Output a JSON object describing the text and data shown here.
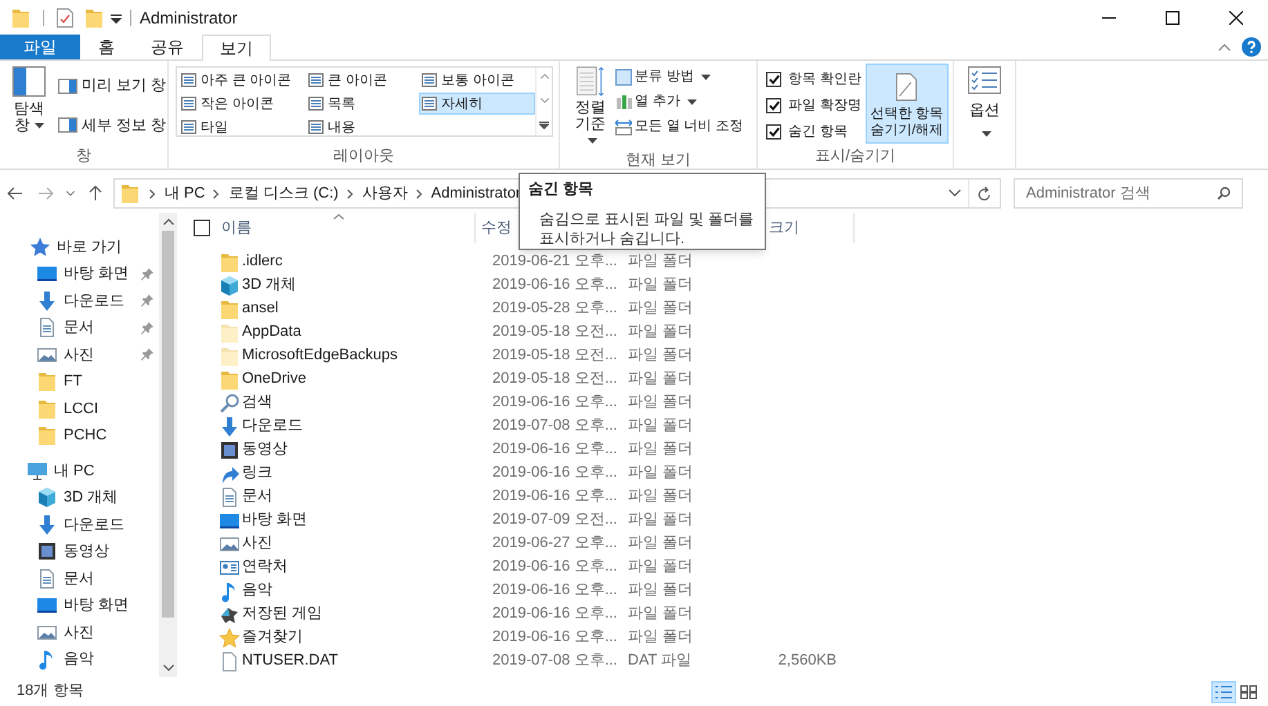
{
  "window": {
    "title": "Administrator"
  },
  "tabs": [
    {
      "label": "파일",
      "kind": "menu",
      "selected": false
    },
    {
      "label": "홈",
      "kind": "tab",
      "selected": false
    },
    {
      "label": "공유",
      "kind": "tab",
      "selected": false
    },
    {
      "label": "보기",
      "kind": "tab",
      "selected": true
    }
  ],
  "ribbon": {
    "panes": {
      "label": "창",
      "navigation_pane": "탐색 창",
      "preview_pane": "미리 보기 창",
      "details_pane": "세부 정보 창"
    },
    "layout": {
      "label": "레이아웃",
      "options": [
        {
          "label": "아주 큰 아이콘",
          "selected": false
        },
        {
          "label": "큰 아이콘",
          "selected": false
        },
        {
          "label": "보통 아이콘",
          "selected": false
        },
        {
          "label": "작은 아이콘",
          "selected": false
        },
        {
          "label": "목록",
          "selected": false
        },
        {
          "label": "자세히",
          "selected": true
        },
        {
          "label": "타일",
          "selected": false
        },
        {
          "label": "내용",
          "selected": false
        }
      ]
    },
    "current_view": {
      "label": "현재 보기",
      "sort_by": "정렬 기준",
      "group_by": "분류 방법",
      "add_columns": "열 추가",
      "size_all_columns": "모든 열 너비 조정"
    },
    "show_hide": {
      "label": "표시/숨기기",
      "options": [
        {
          "label": "항목 확인란",
          "checked": true
        },
        {
          "label": "파일 확장명",
          "checked": true
        },
        {
          "label": "숨긴 항목",
          "checked": true
        }
      ],
      "hide_selected": {
        "label": "선택한 항목 숨기기/해제",
        "highlighted": true
      }
    },
    "options": {
      "label": "옵션"
    }
  },
  "address": {
    "crumbs": [
      "내 PC",
      "로컬 디스크 (C:)",
      "사용자",
      "Administrator"
    ]
  },
  "search": {
    "placeholder": "Administrator 검색"
  },
  "tooltip": {
    "title": "숨긴 항목",
    "text": "숨김으로 표시된 파일 및 폴더를 표시하거나 숨깁니다."
  },
  "navigation": [
    {
      "label": "바로 가기",
      "kind": "quick",
      "children": [
        {
          "label": "바탕 화면",
          "kind": "desktop",
          "pinned": true
        },
        {
          "label": "다운로드",
          "kind": "download",
          "pinned": true
        },
        {
          "label": "문서",
          "kind": "document",
          "pinned": true
        },
        {
          "label": "사진",
          "kind": "picture",
          "pinned": true
        },
        {
          "label": "FT",
          "kind": "folder",
          "pinned": false
        },
        {
          "label": "LCCI",
          "kind": "folder",
          "pinned": false
        },
        {
          "label": "PCHC",
          "kind": "folder",
          "pinned": false
        }
      ]
    },
    {
      "label": "내 PC",
      "kind": "pc",
      "children": [
        {
          "label": "3D 개체",
          "kind": "cube"
        },
        {
          "label": "다운로드",
          "kind": "download"
        },
        {
          "label": "동영상",
          "kind": "video"
        },
        {
          "label": "문서",
          "kind": "document"
        },
        {
          "label": "바탕 화면",
          "kind": "desktop"
        },
        {
          "label": "사진",
          "kind": "picture"
        },
        {
          "label": "음악",
          "kind": "music"
        }
      ]
    }
  ],
  "columns": {
    "select_all_checked": false,
    "name": "이름",
    "date": "수정",
    "size": "크기"
  },
  "files": [
    {
      "name": ".idlerc",
      "kind": "folder",
      "hidden": false,
      "date": "2019-06-21 오후...",
      "type": "파일 폴더"
    },
    {
      "name": "3D 개체",
      "kind": "cube",
      "date": "2019-06-16 오후...",
      "type": "파일 폴더"
    },
    {
      "name": "ansel",
      "kind": "folder",
      "hidden": false,
      "date": "2019-05-28 오후...",
      "type": "파일 폴더"
    },
    {
      "name": "AppData",
      "kind": "folder",
      "hidden": true,
      "date": "2019-05-18 오전...",
      "type": "파일 폴더"
    },
    {
      "name": "MicrosoftEdgeBackups",
      "kind": "folder",
      "hidden": true,
      "date": "2019-05-18 오전...",
      "type": "파일 폴더"
    },
    {
      "name": "OneDrive",
      "kind": "folder",
      "hidden": false,
      "date": "2019-05-18 오전...",
      "type": "파일 폴더"
    },
    {
      "name": "검색",
      "kind": "search",
      "date": "2019-06-16 오후...",
      "type": "파일 폴더"
    },
    {
      "name": "다운로드",
      "kind": "download",
      "date": "2019-07-08 오후...",
      "type": "파일 폴더"
    },
    {
      "name": "동영상",
      "kind": "video",
      "date": "2019-06-16 오후...",
      "type": "파일 폴더"
    },
    {
      "name": "링크",
      "kind": "link",
      "date": "2019-06-16 오후...",
      "type": "파일 폴더"
    },
    {
      "name": "문서",
      "kind": "document",
      "date": "2019-06-16 오후...",
      "type": "파일 폴더"
    },
    {
      "name": "바탕 화면",
      "kind": "desktop",
      "date": "2019-07-09 오전...",
      "type": "파일 폴더"
    },
    {
      "name": "사진",
      "kind": "picture",
      "date": "2019-06-27 오후...",
      "type": "파일 폴더"
    },
    {
      "name": "연락처",
      "kind": "contacts",
      "date": "2019-06-16 오후...",
      "type": "파일 폴더"
    },
    {
      "name": "음악",
      "kind": "music",
      "date": "2019-06-16 오후...",
      "type": "파일 폴더"
    },
    {
      "name": "저장된 게임",
      "kind": "game",
      "date": "2019-06-16 오후...",
      "type": "파일 폴더"
    },
    {
      "name": "즐겨찾기",
      "kind": "star",
      "date": "2019-06-16 오후...",
      "type": "파일 폴더"
    },
    {
      "name": "NTUSER.DAT",
      "kind": "file",
      "date": "2019-07-08 오후...",
      "type": "DAT 파일",
      "size": "2,560KB"
    }
  ],
  "status_bar": {
    "item_count": "18개 항목",
    "view_modes": [
      {
        "selected": true
      },
      {
        "selected": false
      }
    ]
  }
}
